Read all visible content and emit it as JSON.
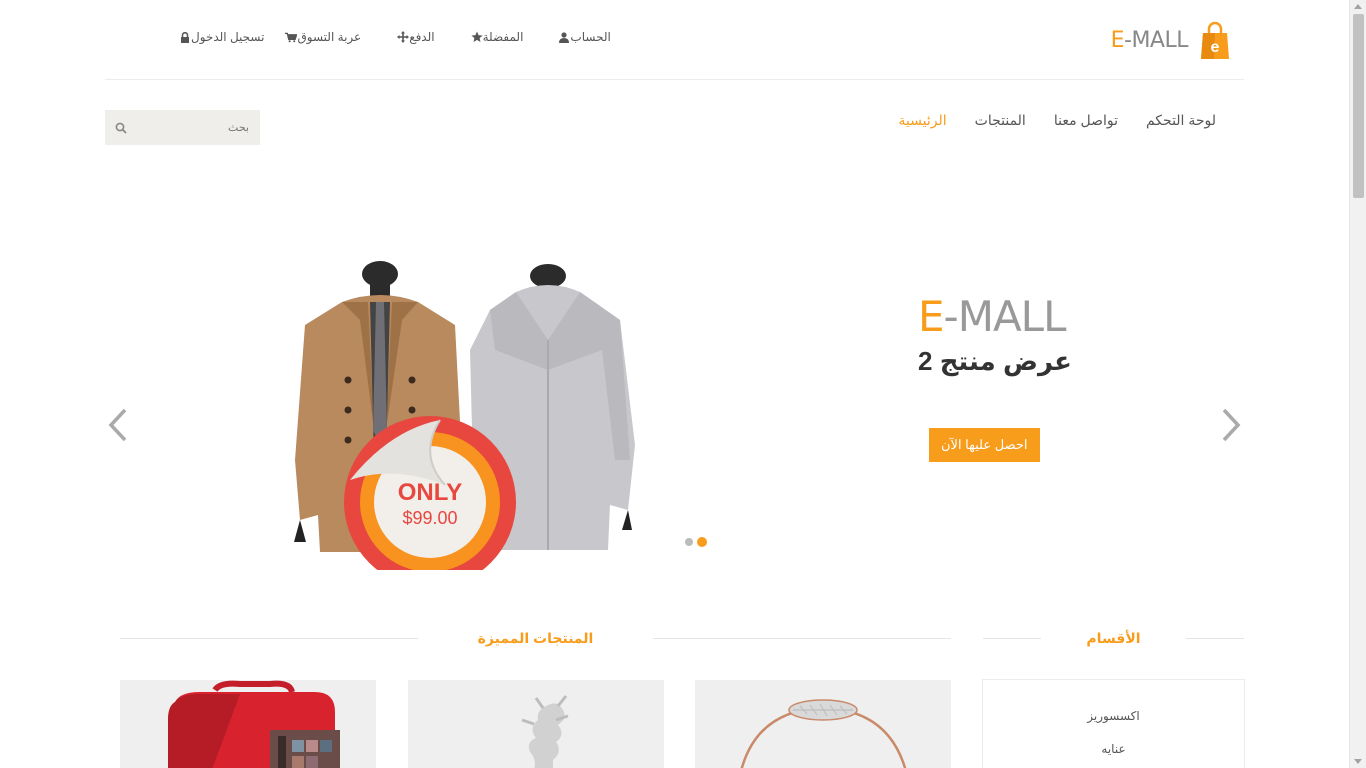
{
  "brand": {
    "logo_e": "E",
    "logo_rest": "-MALL",
    "bag_letter": "e"
  },
  "top_links": [
    {
      "id": "login",
      "label": "تسجيل الدخول",
      "icon": "lock-icon"
    },
    {
      "id": "cart",
      "label": "عربة التسوق",
      "icon": "cart-icon"
    },
    {
      "id": "checkout",
      "label": "الدفع",
      "icon": "crosshairs-icon"
    },
    {
      "id": "wishlist",
      "label": "المفضلة",
      "icon": "star-icon"
    },
    {
      "id": "account",
      "label": "الحساب",
      "icon": "user-icon"
    }
  ],
  "nav": {
    "home": "الرئيسية",
    "products": "المنتجات",
    "contact": "تواصل معنا",
    "dashboard": "لوحة التحكم"
  },
  "search": {
    "placeholder": "بحث"
  },
  "slider": {
    "brand_e": "E",
    "brand_rest": "-MALL",
    "title": "عرض منتج 2",
    "cta": "احصل عليها الآن",
    "badge_top": "ONLY",
    "badge_price": "$99.00",
    "slide_count": 2,
    "active_slide": 2
  },
  "sections": {
    "categories": "الأقسام",
    "featured": "المنتجات المميزة"
  },
  "categories": [
    "اكسسوريز",
    "عنايه"
  ],
  "colors": {
    "accent": "#f89c1c",
    "badge_red": "#e8473f",
    "badge_orange": "#f7931e"
  }
}
